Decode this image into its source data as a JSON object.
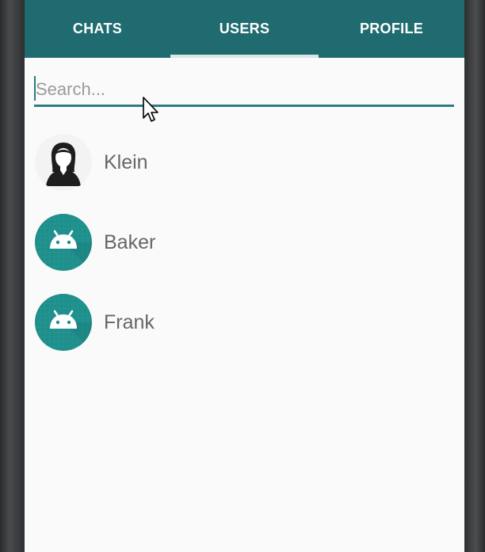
{
  "tabs": [
    {
      "label": "CHATS"
    },
    {
      "label": "USERS"
    },
    {
      "label": "PROFILE"
    }
  ],
  "search": {
    "placeholder": "Search...",
    "value": ""
  },
  "users": [
    {
      "name": "Klein",
      "avatar_icon": "female-user-icon"
    },
    {
      "name": "Baker",
      "avatar_icon": "android-icon"
    },
    {
      "name": "Frank",
      "avatar_icon": "android-icon"
    }
  ],
  "colors": {
    "tab_bar": "#1f6b6f",
    "accent": "#2c7d81",
    "android_avatar": "#1f8f8c",
    "screen_bg": "#fafafa"
  }
}
